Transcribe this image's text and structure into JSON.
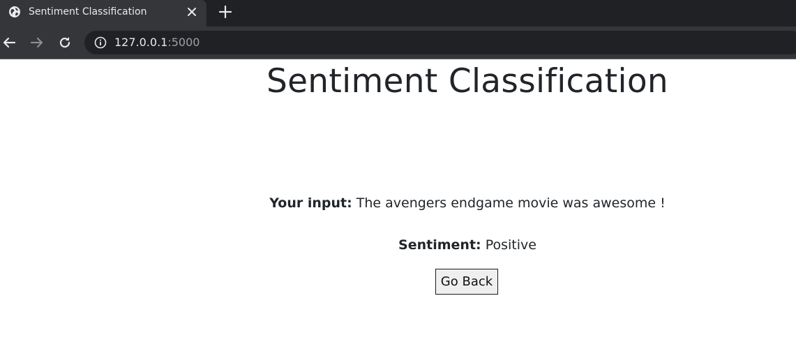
{
  "browser": {
    "tab": {
      "title": "Sentiment Classification"
    },
    "address": {
      "host": "127.0.0.1",
      "port": ":5000"
    },
    "colors": {
      "tabstrip": "#202124",
      "toolbar": "#35363a",
      "text": "#e8eaed"
    }
  },
  "page": {
    "title": "Sentiment Classification",
    "input_label": "Your input:",
    "input_text": "The avengers endgame movie was awesome !",
    "sentiment_label": "Sentiment:",
    "sentiment_value": "Positive",
    "back_button": "Go Back"
  },
  "icons": {
    "tab_favicon": "globe-icon",
    "tab_close": "close-icon",
    "new_tab": "plus-icon",
    "back": "arrow-left-icon",
    "forward": "arrow-right-icon",
    "reload": "reload-icon",
    "site_info": "info-icon"
  }
}
